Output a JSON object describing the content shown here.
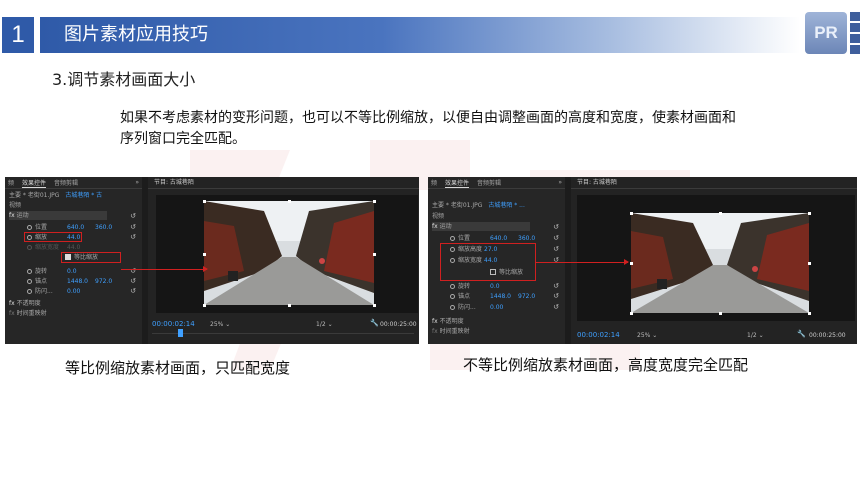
{
  "header": {
    "slide_number": "1",
    "title": "图片素材应用技巧",
    "logo_text": "PR"
  },
  "subtitle": "3.调节素材画面大小",
  "description": "如果不考虑素材的变形问题，也可以不等比例缩放，以便自由调整画面的高度和宽度，使素材画面和序列窗口完全匹配。",
  "left_panel": {
    "tabs": [
      "频",
      "效果控件",
      "音频剪辑"
    ],
    "overflow": "»",
    "clip_path": "主要 * 老街01.JPG",
    "sequence_label": "古城巷陌 * 古",
    "section": "视频",
    "effect": "运动",
    "props": [
      {
        "label": "位置",
        "value": "640.0",
        "value2": "360.0"
      },
      {
        "label": "缩放",
        "value": "44.0",
        "value2": ""
      },
      {
        "label": "缩放宽度",
        "value": "44.0",
        "value2": ""
      },
      {
        "label": "等比缩放",
        "value": "",
        "value2": ""
      },
      {
        "label": "旋转",
        "value": "0.0",
        "value2": ""
      },
      {
        "label": "锚点",
        "value": "1448.0",
        "value2": "972.0"
      },
      {
        "label": "防闪...",
        "value": "0.00",
        "value2": ""
      },
      {
        "label": "不透明度",
        "value": "",
        "value2": ""
      },
      {
        "label": "时间重映射",
        "value": "",
        "value2": ""
      }
    ],
    "monitor_title": "节目: 古城巷陌",
    "timecode": "00:00:02:14",
    "zoom": "25%",
    "quality": "1/2",
    "duration": "00:00:25:00"
  },
  "right_panel": {
    "tabs": [
      "频",
      "效果控件",
      "音频剪辑"
    ],
    "overflow": "»",
    "clip_path": "主要 * 老街01.JPG",
    "sequence_label": "古城巷陌 * ...",
    "section": "视频",
    "effect": "运动",
    "props": [
      {
        "label": "位置",
        "value": "640.0",
        "value2": "360.0"
      },
      {
        "label": "缩放高度",
        "value": "27.0",
        "value2": ""
      },
      {
        "label": "缩放宽度",
        "value": "44.0",
        "value2": ""
      },
      {
        "label": "等比缩放",
        "value": "",
        "value2": ""
      },
      {
        "label": "旋转",
        "value": "0.0",
        "value2": ""
      },
      {
        "label": "锚点",
        "value": "1448.0",
        "value2": "972.0"
      },
      {
        "label": "防闪...",
        "value": "0.00",
        "value2": ""
      },
      {
        "label": "不透明度",
        "value": "",
        "value2": ""
      },
      {
        "label": "时间重映射",
        "value": "",
        "value2": ""
      }
    ],
    "monitor_title": "节目: 古城巷陌",
    "timecode": "00:00:02:14",
    "zoom": "25%",
    "quality": "1/2",
    "duration": "00:00:25:00"
  },
  "captions": {
    "left": "等比例缩放素材画面，只匹配宽度",
    "right": "不等比例缩放素材画面，高度宽度完全匹配"
  },
  "colors": {
    "title_bar": "#2f5aa8",
    "value_blue": "#3fa0ff",
    "highlight_red": "#d02020",
    "panel_bg": "#232323"
  }
}
